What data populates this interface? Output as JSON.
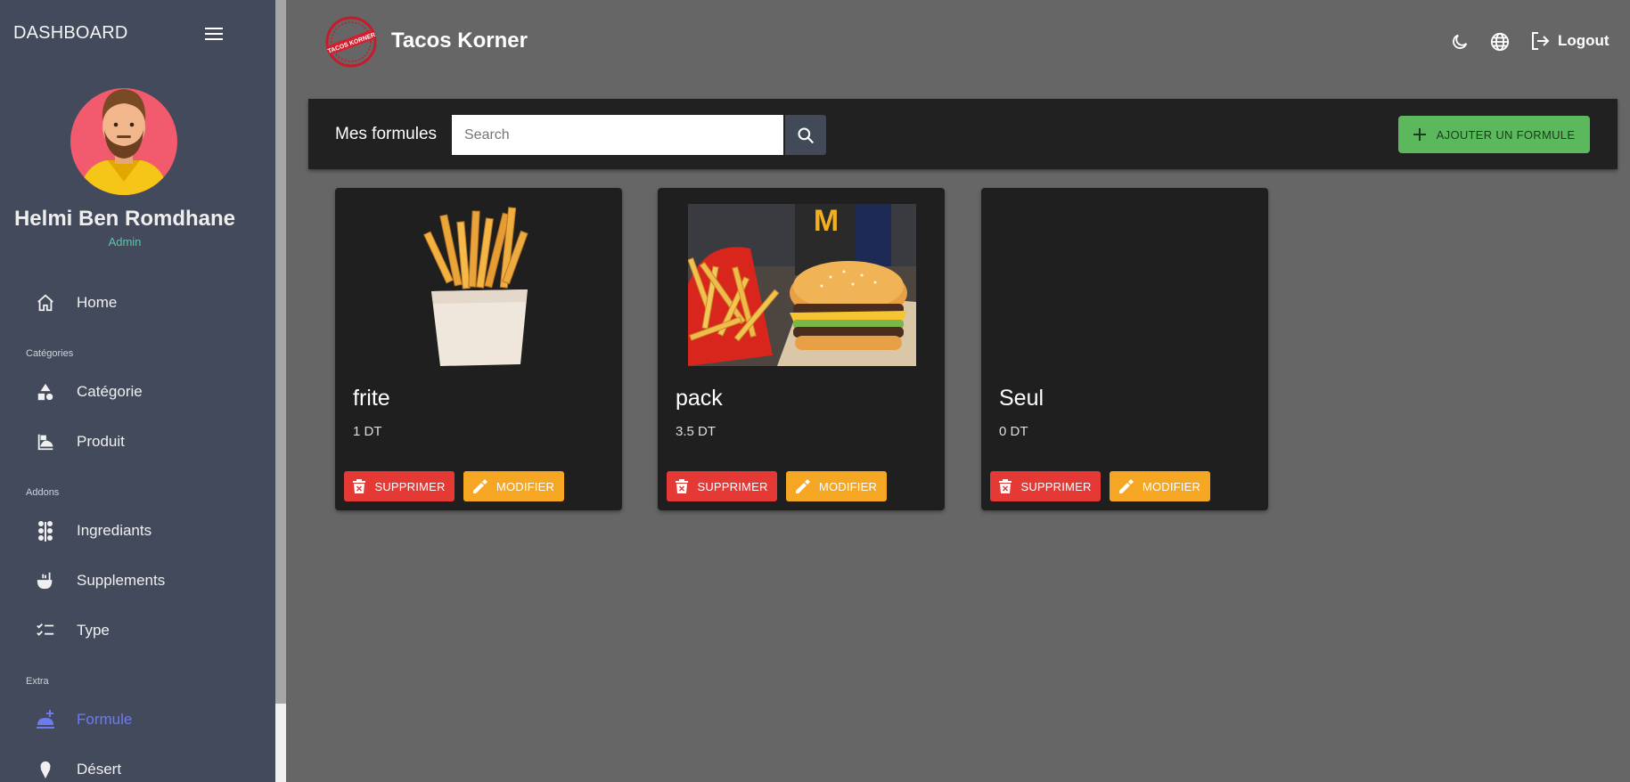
{
  "sidebar": {
    "title": "DASHBOARD",
    "user": {
      "name": "Helmi Ben Romdhane",
      "role": "Admin"
    },
    "sections": {
      "categories": "Catégories",
      "addons": "Addons",
      "extra": "Extra"
    },
    "items": [
      {
        "label": "Home",
        "icon": "home-icon"
      },
      {
        "label": "Catégorie",
        "icon": "shapes-icon"
      },
      {
        "label": "Produit",
        "icon": "product-icon"
      },
      {
        "label": "Ingrediants",
        "icon": "ingredients-icon"
      },
      {
        "label": "Supplements",
        "icon": "ladle-icon"
      },
      {
        "label": "Type",
        "icon": "checklist-icon"
      },
      {
        "label": "Formule",
        "icon": "food-tray-icon",
        "active": true
      },
      {
        "label": "Désert",
        "icon": "ice-cream-icon"
      }
    ]
  },
  "header": {
    "brand": "Tacos Korner",
    "logo_text": "TACOS KORNER",
    "logout": "Logout"
  },
  "toolbar": {
    "title": "Mes formules",
    "search_placeholder": "Search",
    "add_label": "AJOUTER UN FORMULE"
  },
  "cards": [
    {
      "title": "frite",
      "price": "1 DT",
      "delete_label": "SUPPRIMER",
      "edit_label": "MODIFIER"
    },
    {
      "title": "pack",
      "price": "3.5 DT",
      "delete_label": "SUPPRIMER",
      "edit_label": "MODIFIER"
    },
    {
      "title": "Seul",
      "price": "0 DT",
      "delete_label": "SUPPRIMER",
      "edit_label": "MODIFIER"
    }
  ],
  "colors": {
    "sidebar_bg": "#434a5c",
    "page_bg": "#666666",
    "card_bg": "#1f1f1f",
    "accent_active": "#6c7bf0",
    "delete": "#e53935",
    "edit": "#f5a623",
    "add": "#5cb85c",
    "role": "#55c9a6"
  }
}
